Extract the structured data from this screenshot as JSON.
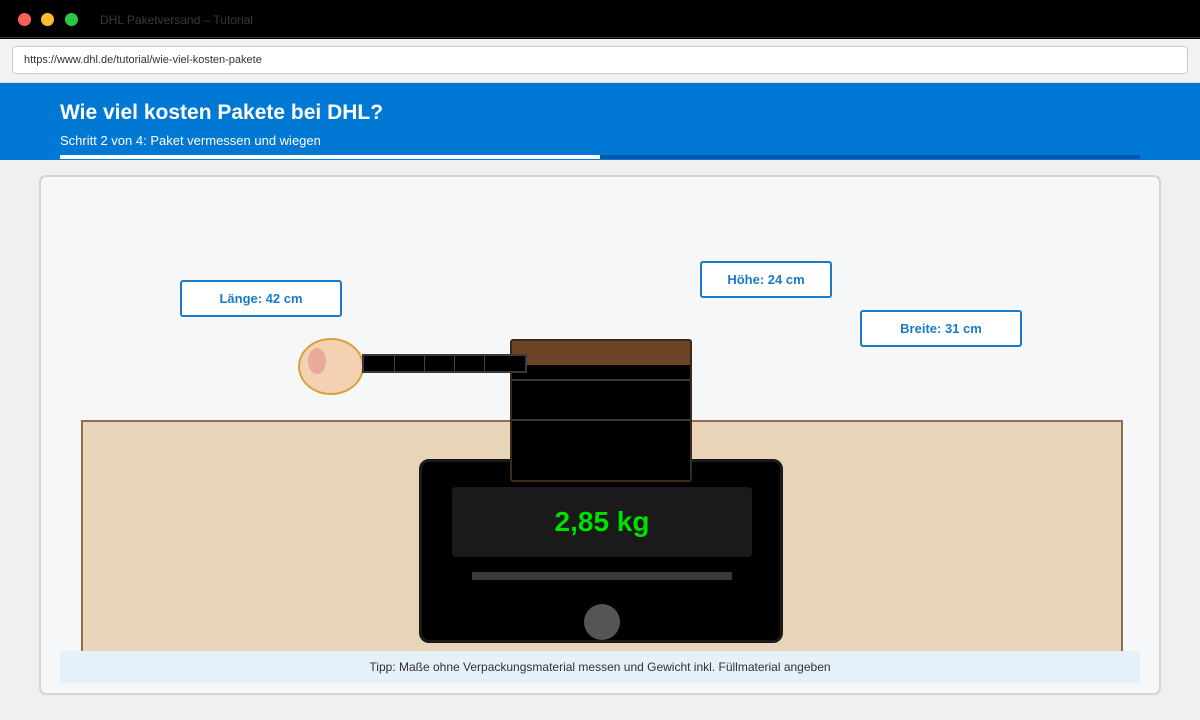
{
  "window": {
    "title": "DHL Paketversand – Tutorial"
  },
  "browser": {
    "url": "https://www.dhl.de/tutorial/wie-viel-kosten-pakete"
  },
  "header": {
    "title": "Wie viel kosten Pakete bei DHL?",
    "step": "Schritt 2 von 4: Paket vermessen und wiegen",
    "progress_fraction": 0.5
  },
  "illustration": {
    "laenge_label": "Länge: 42 cm",
    "hoehe_label": "Höhe: 24 cm",
    "breite_label": "Breite: 31 cm",
    "scale_reading": "2,85 kg"
  },
  "tip": "Tipp: Maße ohne Verpackungsmaterial messen und Gewicht inkl. Füllmaterial angeben",
  "colors": {
    "brand_blue": "#0078d4",
    "display_green": "#00e000",
    "label_blue": "#1a7bc8"
  }
}
